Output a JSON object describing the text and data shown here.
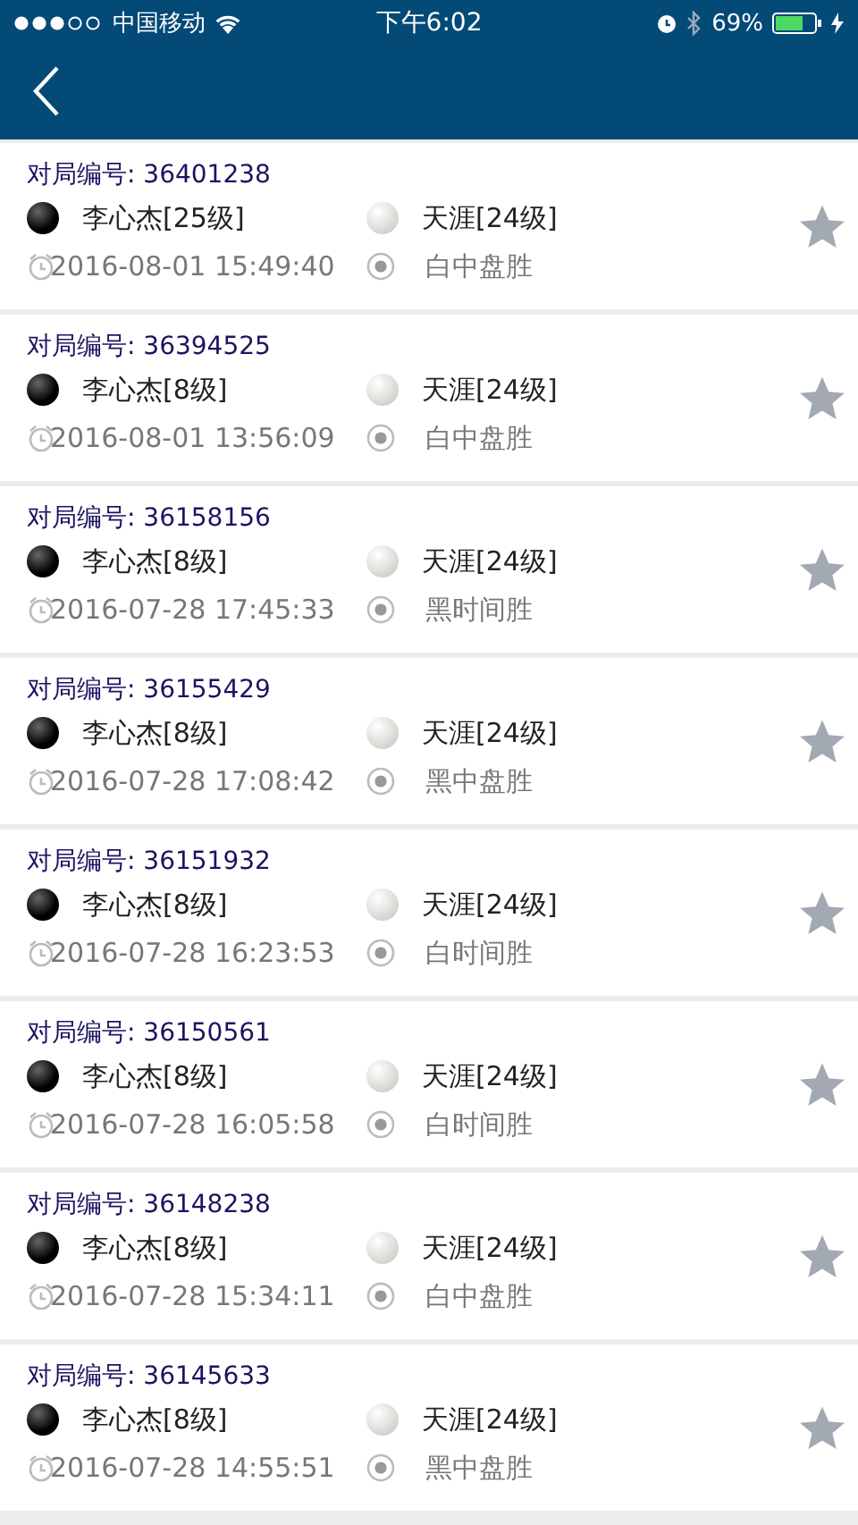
{
  "status_bar": {
    "carrier": "中国移动",
    "time": "下午6:02",
    "battery": "69%"
  },
  "games": [
    {
      "label": "对局编号:",
      "id": "36401238",
      "black": "李心杰[25级]",
      "white": "天涯[24级]",
      "date": "2016-08-01 15:49:40",
      "result": "白中盘胜",
      "favorite": false
    },
    {
      "label": "对局编号:",
      "id": "36394525",
      "black": "李心杰[8级]",
      "white": "天涯[24级]",
      "date": "2016-08-01 13:56:09",
      "result": "白中盘胜",
      "favorite": false
    },
    {
      "label": "对局编号:",
      "id": "36158156",
      "black": "李心杰[8级]",
      "white": "天涯[24级]",
      "date": "2016-07-28 17:45:33",
      "result": "黑时间胜",
      "favorite": false
    },
    {
      "label": "对局编号:",
      "id": "36155429",
      "black": "李心杰[8级]",
      "white": "天涯[24级]",
      "date": "2016-07-28 17:08:42",
      "result": "黑中盘胜",
      "favorite": false
    },
    {
      "label": "对局编号:",
      "id": "36151932",
      "black": "李心杰[8级]",
      "white": "天涯[24级]",
      "date": "2016-07-28 16:23:53",
      "result": "白时间胜",
      "favorite": false
    },
    {
      "label": "对局编号:",
      "id": "36150561",
      "black": "李心杰[8级]",
      "white": "天涯[24级]",
      "date": "2016-07-28 16:05:58",
      "result": "白时间胜",
      "favorite": false
    },
    {
      "label": "对局编号:",
      "id": "36148238",
      "black": "李心杰[8级]",
      "white": "天涯[24级]",
      "date": "2016-07-28 15:34:11",
      "result": "白中盘胜",
      "favorite": false
    },
    {
      "label": "对局编号:",
      "id": "36145633",
      "black": "李心杰[8级]",
      "white": "天涯[24级]",
      "date": "2016-07-28 14:55:51",
      "result": "黑中盘胜",
      "favorite": false
    }
  ]
}
